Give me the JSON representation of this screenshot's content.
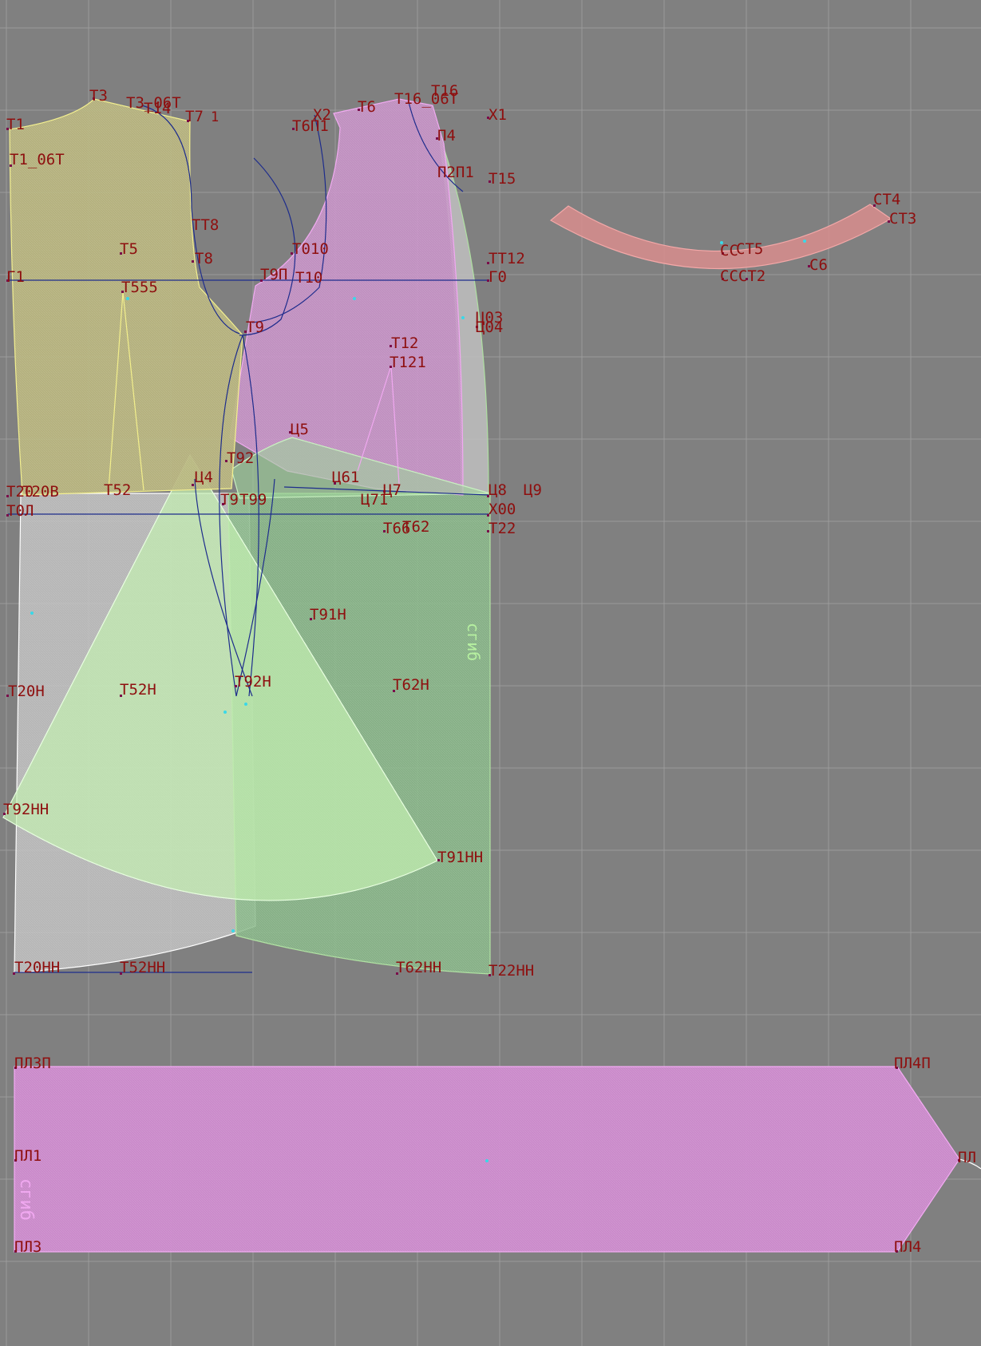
{
  "colors": {
    "background": "#808080",
    "grid": "#9a9a9a",
    "label": "#8e0f0f",
    "bodice_back": "#b3b07a",
    "bodice_front": "#c48cc4",
    "side_strip": "#b9b9b9",
    "skirt_back": "#bdbdbd",
    "skirt_front": "#8fbf8f",
    "godet": "#b9e6a8",
    "band": "#cc88cc",
    "collar": "#d98a8a",
    "construction_line": "#1d2c8c"
  },
  "labels": {
    "T3": "Т3",
    "T3_06T": "Т3_06Т",
    "T1": "Т1",
    "T14": "Т14",
    "T7": "Т7",
    "T71": "1",
    "T1_06T": "Т1_06Т",
    "TT8": "ТТ8",
    "T5": "Т5",
    "T8": "Т8",
    "G1": "Г1",
    "T555": "Т555",
    "X2": "Х2",
    "T6": "Т6",
    "T16": "Т16",
    "T16_06T": "Т16_06Т",
    "X1": "Х1",
    "T6P1": "Т6П1",
    "P4": "П4",
    "P2P1": "П2П1",
    "T15": "Т15",
    "T010": "Т010",
    "TT12": "ТТ12",
    "G0": "Г0",
    "T9P": "Т9П",
    "T10": "Т10",
    "T9": "Т9",
    "TS3": "Ц03",
    "TS4": "Ц04",
    "T12": "Т12",
    "T121": "Т121",
    "TS5": "Ц5",
    "T92": "Т92",
    "TS61": "Ц61",
    "TS7": "Ц7",
    "TS71": "Ц71",
    "TS8": "Ц8",
    "TS9": "Ц9",
    "T20": "Т20",
    "T20V": "Т20В",
    "T52": "Т52",
    "TS4b": "Ц4",
    "T91": "Т9",
    "T99": "Т99",
    "T0L": "Т0Л",
    "X00": "Х00",
    "T22": "Т22",
    "T66": "Т66",
    "T62": "Т62",
    "T91H": "Т91Н",
    "T92H": "Т92Н",
    "T20H": "Т20Н",
    "T52H": "Т52Н",
    "T62H": "Т62Н",
    "T92HH": "Т92НН",
    "T91HH": "Т91НН",
    "T20HH": "Т20НН",
    "T52HH": "Т52НН",
    "T62HH": "Т62НН",
    "T22HH": "Т22НН",
    "CT4": "СТ4",
    "CT3": "СТ3",
    "CCT5": "СТ5",
    "CC": "СС",
    "CCT2": "СССТ2",
    "C6": "С6",
    "PL3P": "ПЛ3П",
    "PL4P": "ПЛ4П",
    "PL1": "ПЛ1",
    "PL": "ПЛ",
    "PL3": "ПЛ3",
    "PL4": "ПЛ4",
    "fold_skirt": "сгиб",
    "fold_band": "сгиб"
  }
}
